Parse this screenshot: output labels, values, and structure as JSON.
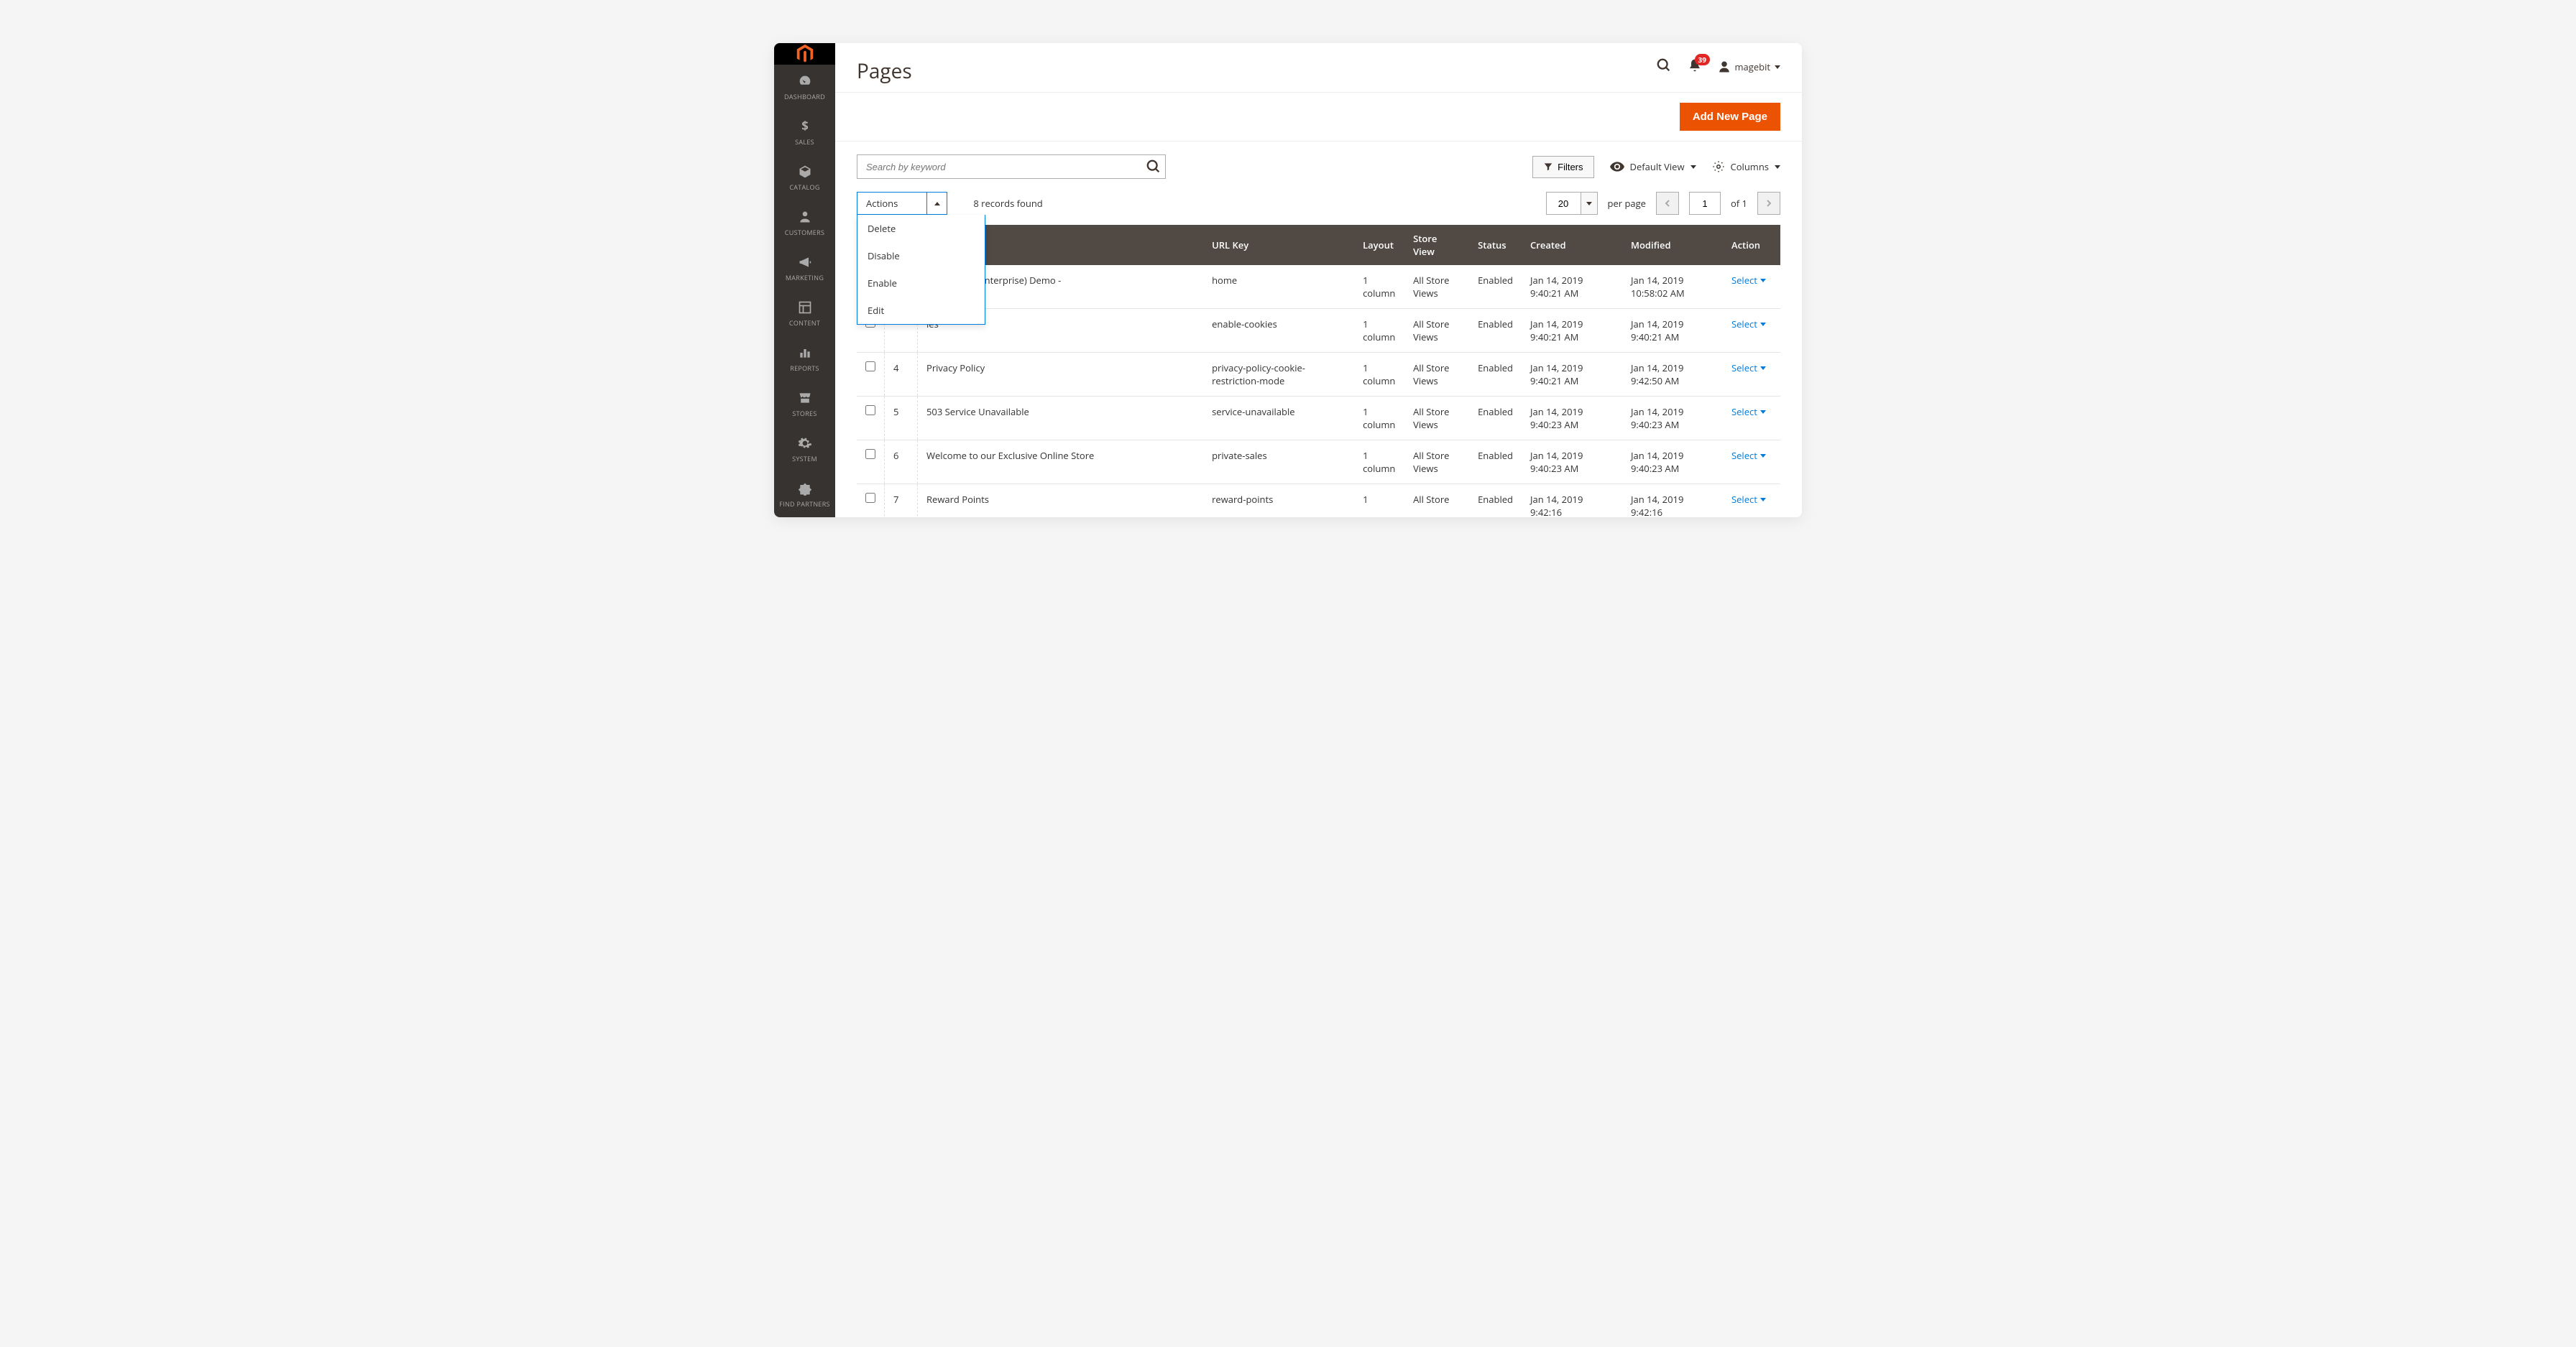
{
  "sidebar": {
    "items": [
      {
        "label": "DASHBOARD",
        "icon": "gauge"
      },
      {
        "label": "SALES",
        "icon": "dollar"
      },
      {
        "label": "CATALOG",
        "icon": "cube"
      },
      {
        "label": "CUSTOMERS",
        "icon": "person"
      },
      {
        "label": "MARKETING",
        "icon": "megaphone"
      },
      {
        "label": "CONTENT",
        "icon": "layout"
      },
      {
        "label": "REPORTS",
        "icon": "bars"
      },
      {
        "label": "STORES",
        "icon": "storefront"
      },
      {
        "label": "SYSTEM",
        "icon": "gear"
      },
      {
        "label": "FIND PARTNERS",
        "icon": "partners"
      }
    ]
  },
  "header": {
    "title": "Pages",
    "notifications": "39",
    "username": "magebit"
  },
  "toolbar": {
    "add_button": "Add New Page"
  },
  "filters": {
    "search_placeholder": "Search by keyword",
    "filters_label": "Filters",
    "default_view_label": "Default View",
    "columns_label": "Columns"
  },
  "actions": {
    "label": "Actions",
    "menu": [
      "Delete",
      "Disable",
      "Enable",
      "Edit"
    ],
    "records_found": "8 records found",
    "page_size": "20",
    "per_page_label": "per page",
    "current_page": "1",
    "total_pages_label": "of 1"
  },
  "table": {
    "headers": [
      "",
      "",
      "",
      "URL Key",
      "Layout",
      "Store View",
      "Status",
      "Created",
      "Modified",
      "Action"
    ],
    "select_label": "Select",
    "rows": [
      {
        "id": "",
        "title": "Commerce (Enterprise) Demo -",
        "url_key": "home",
        "layout": "1 column",
        "store_view": "All Store Views",
        "status": "Enabled",
        "created": "Jan 14, 2019 9:40:21 AM",
        "modified": "Jan 14, 2019 10:58:02 AM"
      },
      {
        "id": "",
        "title": "ies",
        "url_key": "enable-cookies",
        "layout": "1 column",
        "store_view": "All Store Views",
        "status": "Enabled",
        "created": "Jan 14, 2019 9:40:21 AM",
        "modified": "Jan 14, 2019 9:40:21 AM"
      },
      {
        "id": "4",
        "title": "Privacy Policy",
        "url_key": "privacy-policy-cookie-restriction-mode",
        "layout": "1 column",
        "store_view": "All Store Views",
        "status": "Enabled",
        "created": "Jan 14, 2019 9:40:21 AM",
        "modified": "Jan 14, 2019 9:42:50 AM"
      },
      {
        "id": "5",
        "title": "503 Service Unavailable",
        "url_key": "service-unavailable",
        "layout": "1 column",
        "store_view": "All Store Views",
        "status": "Enabled",
        "created": "Jan 14, 2019 9:40:23 AM",
        "modified": "Jan 14, 2019 9:40:23 AM"
      },
      {
        "id": "6",
        "title": "Welcome to our Exclusive Online Store",
        "url_key": "private-sales",
        "layout": "1 column",
        "store_view": "All Store Views",
        "status": "Enabled",
        "created": "Jan 14, 2019 9:40:23 AM",
        "modified": "Jan 14, 2019 9:40:23 AM"
      },
      {
        "id": "7",
        "title": "Reward Points",
        "url_key": "reward-points",
        "layout": "1",
        "store_view": "All Store",
        "status": "Enabled",
        "created": "Jan 14, 2019 9:42:16",
        "modified": "Jan 14, 2019 9:42:16"
      }
    ]
  }
}
